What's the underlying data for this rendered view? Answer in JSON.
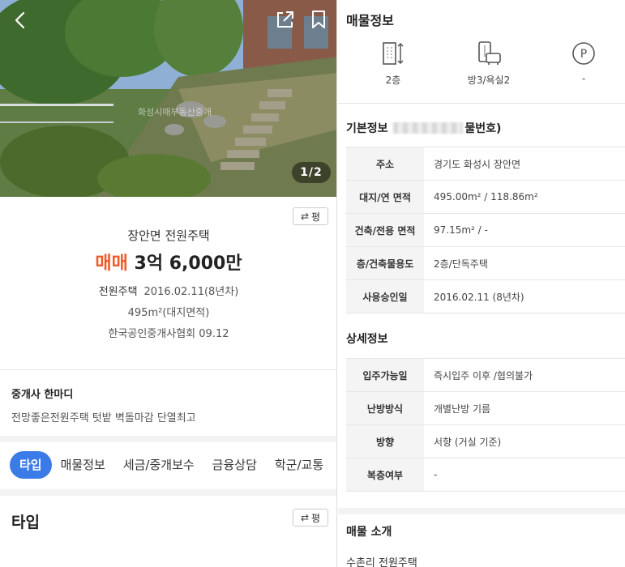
{
  "photo": {
    "counter": "1/2",
    "watermark": "화성시매부동산중개"
  },
  "icons": {
    "back": "chevron-left-icon",
    "share": "share-icon",
    "bookmark": "bookmark-icon",
    "swap": "swap-icon"
  },
  "listing": {
    "compare_label": "평",
    "name": "장안면 전원주택",
    "deal_type": "매매",
    "price": "3억 6,000만",
    "type_label": "전원주택",
    "type_detail": "2016.02.11(8년차)",
    "area": "495m²(대지면적)",
    "source": "한국공인중개사협회 09.12"
  },
  "agent_note": {
    "heading": "중개사 한마디",
    "text": "전망좋은전원주택 텃밭 벽돌마감 단열최고"
  },
  "tabs": [
    {
      "label": "타입",
      "active": true
    },
    {
      "label": "매물정보",
      "active": false
    },
    {
      "label": "세금/중개보수",
      "active": false
    },
    {
      "label": "금융상담",
      "active": false
    },
    {
      "label": "학군/교통",
      "active": false
    }
  ],
  "type_section": {
    "title": "타입",
    "compare_label": "평"
  },
  "property_info": {
    "title": "매물정보",
    "features": [
      {
        "icon": "floor-icon",
        "label": "2층"
      },
      {
        "icon": "room-bath-icon",
        "label": "방3/욕실2"
      },
      {
        "icon": "parking-icon",
        "label": "-"
      }
    ]
  },
  "basic_info": {
    "title_prefix": "기본정보",
    "title_suffix": "물번호)",
    "rows": [
      {
        "key": "주소",
        "value": "경기도 화성시 장안면"
      },
      {
        "key": "대지/연 면적",
        "value": "495.00m² / 118.86m²"
      },
      {
        "key": "건축/전용 면적",
        "value": "97.15m² / -"
      },
      {
        "key": "층/건축물용도",
        "value": "2층/단독주택"
      },
      {
        "key": "사용승인일",
        "value": "2016.02.11 (8년차)"
      }
    ]
  },
  "detail_info": {
    "title": "상세정보",
    "rows": [
      {
        "key": "입주가능일",
        "value": "즉시입주 이후 /협의불가"
      },
      {
        "key": "난방방식",
        "value": "개별난방 기름"
      },
      {
        "key": "방향",
        "value": "서향 (거실 기준)"
      },
      {
        "key": "복층여부",
        "value": "-"
      }
    ]
  },
  "intro": {
    "title": "매물 소개",
    "text": "수촌리 전원주택"
  },
  "colors": {
    "accent_blue": "#3b7be8",
    "deal_orange": "#f05a28"
  }
}
